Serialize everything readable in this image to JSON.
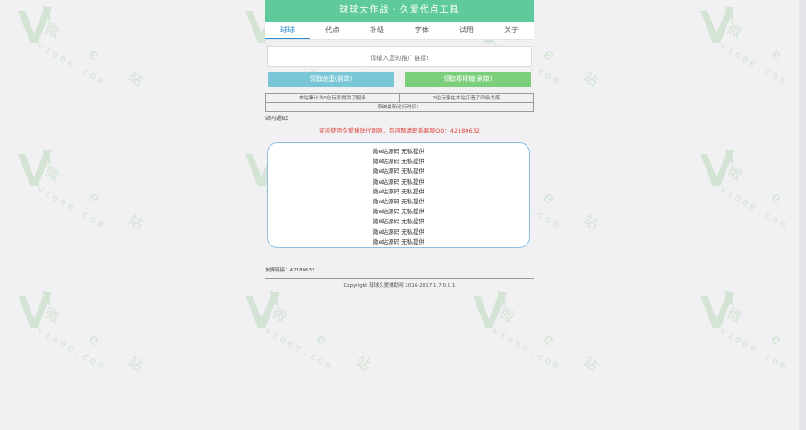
{
  "watermark": {
    "text": "微 e 站",
    "url": "vioee.com",
    "color": "#9ccf9c"
  },
  "app": {
    "title": "球球大作战 · 久爱代点工具",
    "tabs": [
      {
        "label": "球球",
        "active": true
      },
      {
        "label": "代点",
        "active": false
      },
      {
        "label": "补级",
        "active": false
      },
      {
        "label": "字体",
        "active": false
      },
      {
        "label": "试用",
        "active": false
      },
      {
        "label": "关于",
        "active": false
      }
    ],
    "input_placeholder": "请输入您的推广链接!",
    "buttons": {
      "left": "领取龙蛋(刷单)",
      "right": "领取棒棒糖(刷单)"
    },
    "info": {
      "left": "本站累计为0位玩家提供了服务",
      "right": "0位玩家在本站打造了四级龙蛋",
      "bottom": "系统最新运行时间："
    },
    "notice_title": "站内通知：",
    "notice_text": "欢迎使用久爱球球代刷网，有问题请联系客服QQ：42180632",
    "list_items": [
      "微e站源码 无私提供",
      "微e站源码 无私提供",
      "微e站源码 无私提供",
      "微e站源码 无私提供",
      "微e站源码 无私提供",
      "微e站源码 无私提供",
      "微e站源码 无私提供",
      "微e站源码 无私提供",
      "微e站源码 无私提供",
      "微e站源码 无私提供"
    ],
    "contact": "友情链接：42180632",
    "footer": "Copyright 球球久爱辅助网 2016-2017 1.7.0.0.1",
    "colors": {
      "title_bar": "#5fcb9c",
      "active_tab": "#2e8ccf",
      "btn_left": "#79c7d6",
      "btn_right": "#7bcf7a",
      "notice": "#e0463c",
      "list_border": "#8fbfe0"
    }
  }
}
